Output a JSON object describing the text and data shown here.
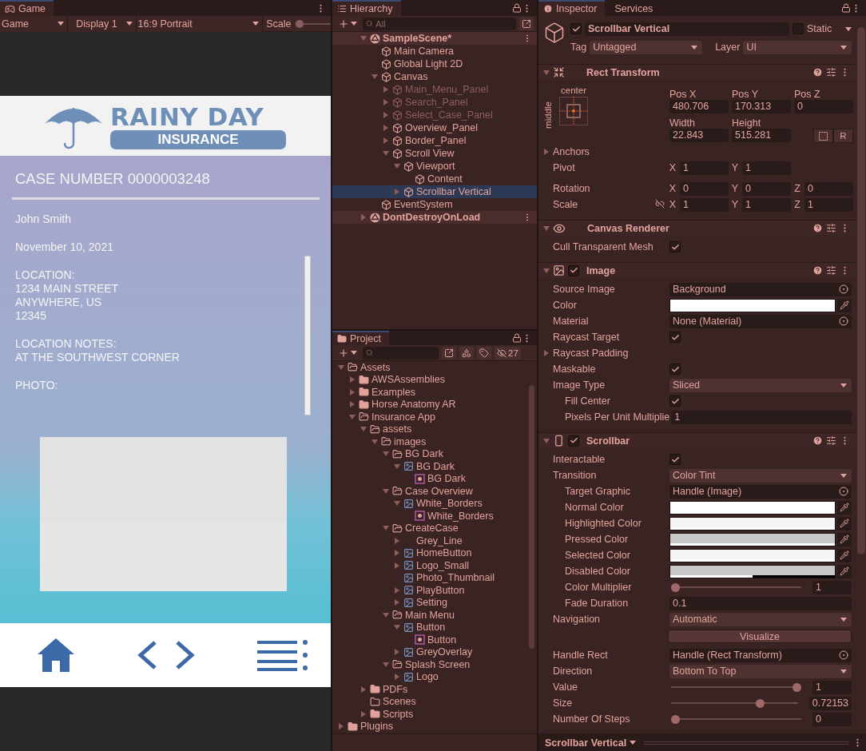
{
  "game": {
    "tab": "Game",
    "toolbar": {
      "mode": "Game",
      "display": "Display 1",
      "aspect": "16:9 Portrait",
      "scale_label": "Scale",
      "scale": {
        "level": 0
      }
    },
    "app": {
      "logo": {
        "title": "RAINY DAY",
        "subtitle": "INSURANCE"
      },
      "case_number": "CASE NUMBER 0000003248",
      "blocks": [
        {
          "lines": [
            "John Smith"
          ]
        },
        {
          "lines": [
            "November 10, 2021"
          ]
        },
        {
          "lines": [
            "LOCATION:",
            "1234 MAIN STREET",
            "ANYWHERE, US",
            "12345"
          ]
        },
        {
          "lines": [
            "LOCATION NOTES:",
            "AT THE SOUTHWEST CORNER"
          ]
        },
        {
          "lines": [
            "PHOTO:"
          ]
        }
      ]
    }
  },
  "hierarchy": {
    "tab": "Hierarchy",
    "search_placeholder": "All",
    "items": [
      {
        "name": "SampleScene*",
        "kind": "scene",
        "expanded": true,
        "selected": false,
        "disabled": false,
        "children": [
          {
            "name": "Main Camera",
            "kind": "object",
            "selected": false,
            "disabled": false
          },
          {
            "name": "Global Light 2D",
            "kind": "object",
            "selected": false,
            "disabled": false
          },
          {
            "name": "Canvas",
            "kind": "object",
            "expanded": true,
            "selected": false,
            "disabled": false,
            "children": [
              {
                "name": "Main_Menu_Panel",
                "kind": "object",
                "expanded": false,
                "selected": false,
                "disabled": true
              },
              {
                "name": "Search_Panel",
                "kind": "object",
                "expanded": false,
                "selected": false,
                "disabled": true
              },
              {
                "name": "Select_Case_Panel",
                "kind": "object",
                "expanded": false,
                "selected": false,
                "disabled": true
              },
              {
                "name": "Overview_Panel",
                "kind": "object",
                "expanded": false,
                "selected": false,
                "disabled": false
              },
              {
                "name": "Border_Panel",
                "kind": "object",
                "expanded": false,
                "selected": false,
                "disabled": false
              },
              {
                "name": "Scroll View",
                "kind": "object",
                "expanded": true,
                "selected": false,
                "disabled": false,
                "children": [
                  {
                    "name": "Viewport",
                    "kind": "object",
                    "expanded": true,
                    "selected": false,
                    "disabled": false,
                    "children": [
                      {
                        "name": "Content",
                        "kind": "object",
                        "selected": false,
                        "disabled": false
                      }
                    ]
                  },
                  {
                    "name": "Scrollbar Vertical",
                    "kind": "object",
                    "expanded": false,
                    "selected": true,
                    "disabled": false
                  }
                ]
              }
            ]
          },
          {
            "name": "EventSystem",
            "kind": "object",
            "selected": false,
            "disabled": false
          }
        ]
      },
      {
        "name": "DontDestroyOnLoad",
        "kind": "scene",
        "expanded": false,
        "selected": false,
        "disabled": false
      }
    ]
  },
  "project": {
    "tab": "Project",
    "hidden_count": "27",
    "items": [
      {
        "name": "Assets",
        "kind": "folder",
        "expanded": true,
        "children": [
          {
            "name": "AWSAssemblies",
            "kind": "folder",
            "expanded": false
          },
          {
            "name": "Examples",
            "kind": "folder",
            "expanded": false
          },
          {
            "name": "Horse Anatomy AR",
            "kind": "folder",
            "expanded": false
          },
          {
            "name": "Insurance App",
            "kind": "folder",
            "expanded": true,
            "children": [
              {
                "name": "assets",
                "kind": "folder",
                "expanded": true,
                "children": [
                  {
                    "name": "images",
                    "kind": "folder",
                    "expanded": true,
                    "children": [
                      {
                        "name": "BG Dark",
                        "kind": "folder",
                        "expanded": true,
                        "children": [
                          {
                            "name": "BG Dark",
                            "kind": "texture",
                            "expanded": true,
                            "children": [
                              {
                                "name": "BG Dark",
                                "kind": "sprite"
                              }
                            ]
                          }
                        ]
                      },
                      {
                        "name": "Case Overview",
                        "kind": "folder",
                        "expanded": true,
                        "children": [
                          {
                            "name": "White_Borders",
                            "kind": "texture",
                            "expanded": true,
                            "children": [
                              {
                                "name": "White_Borders",
                                "kind": "sprite"
                              }
                            ]
                          }
                        ]
                      },
                      {
                        "name": "CreateCase",
                        "kind": "folder",
                        "expanded": true,
                        "children": [
                          {
                            "name": "Grey_Line",
                            "kind": "blank",
                            "expanded": false
                          },
                          {
                            "name": "HomeButton",
                            "kind": "texture",
                            "expanded": false
                          },
                          {
                            "name": "Logo_Small",
                            "kind": "texture",
                            "expanded": false
                          },
                          {
                            "name": "Photo_Thumbnail",
                            "kind": "texture"
                          },
                          {
                            "name": "PlayButton",
                            "kind": "texture",
                            "expanded": false
                          },
                          {
                            "name": "Setting",
                            "kind": "texture",
                            "expanded": false
                          }
                        ]
                      },
                      {
                        "name": "Main Menu",
                        "kind": "folder",
                        "expanded": true,
                        "children": [
                          {
                            "name": "Button",
                            "kind": "texture",
                            "expanded": true,
                            "children": [
                              {
                                "name": "Button",
                                "kind": "sprite"
                              }
                            ]
                          },
                          {
                            "name": "GreyOverlay",
                            "kind": "texture",
                            "expanded": false
                          }
                        ]
                      },
                      {
                        "name": "Splash Screen",
                        "kind": "folder",
                        "expanded": true,
                        "children": [
                          {
                            "name": "Logo",
                            "kind": "texture",
                            "expanded": false
                          }
                        ]
                      }
                    ]
                  }
                ]
              },
              {
                "name": "PDFs",
                "kind": "folder",
                "expanded": false
              },
              {
                "name": "Scenes",
                "kind": "empty-folder"
              },
              {
                "name": "Scripts",
                "kind": "folder",
                "expanded": false
              }
            ]
          }
        ]
      },
      {
        "name": "Plugins",
        "kind": "folder",
        "expanded": false
      }
    ]
  },
  "inspector": {
    "tabs": [
      {
        "label": "Inspector",
        "selected": true
      },
      {
        "label": "Services",
        "selected": false
      }
    ],
    "object": {
      "active": true,
      "name": "Scrollbar Vertical",
      "static": false,
      "static_label": "Static",
      "tag_label": "Tag",
      "tag": "Untagged",
      "layer_label": "Layer",
      "layer": "UI"
    },
    "rect_transform": {
      "title": "Rect Transform",
      "anchor": {
        "horizontal": "center",
        "vertical": "middle"
      },
      "fields": [
        {
          "label": "Pos X",
          "value": "480.706"
        },
        {
          "label": "Pos Y",
          "value": "170.313"
        },
        {
          "label": "Pos Z",
          "value": "0"
        },
        {
          "label": "Width",
          "value": "22.843"
        },
        {
          "label": "Height",
          "value": "515.281"
        }
      ],
      "raw_button": "R",
      "anchors": "Anchors",
      "vectors": [
        {
          "label": "Pivot",
          "axes": [
            {
              "axis": "X",
              "value": "1"
            },
            {
              "axis": "Y",
              "value": "1"
            }
          ]
        },
        {
          "label": "Rotation",
          "axes": [
            {
              "axis": "X",
              "value": "0"
            },
            {
              "axis": "Y",
              "value": "0"
            },
            {
              "axis": "Z",
              "value": "0"
            }
          ]
        },
        {
          "label": "Scale",
          "linked": false,
          "axes": [
            {
              "axis": "X",
              "value": "1"
            },
            {
              "axis": "Y",
              "value": "1"
            },
            {
              "axis": "Z",
              "value": "1"
            }
          ]
        }
      ]
    },
    "components": [
      {
        "title": "Canvas Renderer",
        "kind": "canvas-renderer",
        "properties": [
          {
            "kind": "check",
            "label": "Cull Transparent Mesh",
            "checked": true
          }
        ]
      },
      {
        "title": "Image",
        "kind": "image",
        "enabled": true,
        "properties": [
          {
            "kind": "object",
            "label": "Source Image",
            "value": "Background"
          },
          {
            "kind": "color",
            "label": "Color",
            "color": "#ffffff",
            "level": 1
          },
          {
            "kind": "object",
            "label": "Material",
            "value": "None (Material)"
          },
          {
            "kind": "check",
            "label": "Raycast Target",
            "checked": true
          },
          {
            "kind": "foldout",
            "label": "Raycast Padding"
          },
          {
            "kind": "check",
            "label": "Maskable",
            "checked": true
          },
          {
            "kind": "dropdown",
            "label": "Image Type",
            "value": "Sliced",
            "children": [
              {
                "kind": "check",
                "label": "Fill Center",
                "checked": true
              },
              {
                "kind": "field",
                "label": "Pixels Per Unit Multiplie",
                "value": "1"
              }
            ]
          }
        ]
      },
      {
        "title": "Scrollbar",
        "kind": "scrollbar",
        "enabled": true,
        "properties": [
          {
            "kind": "check",
            "label": "Interactable",
            "checked": true
          },
          {
            "kind": "dropdown",
            "label": "Transition",
            "value": "Color Tint",
            "children": [
              {
                "kind": "object",
                "label": "Target Graphic",
                "value": "Handle (Image)"
              },
              {
                "kind": "color",
                "label": "Normal Color",
                "color": "#ffffff",
                "level": 1
              },
              {
                "kind": "color",
                "label": "Highlighted Color",
                "color": "#f5f5f5",
                "level": 1
              },
              {
                "kind": "color",
                "label": "Pressed Color",
                "color": "#c8c8c8",
                "level": 1
              },
              {
                "kind": "color",
                "label": "Selected Color",
                "color": "#f5f5f5",
                "level": 1
              },
              {
                "kind": "color",
                "label": "Disabled Color",
                "color": "#c8c8c8",
                "level": 0.5
              },
              {
                "kind": "slider",
                "label": "Color Multiplier",
                "level": 0,
                "value": "1"
              },
              {
                "kind": "field",
                "label": "Fade Duration",
                "value": "0.1"
              }
            ]
          },
          {
            "kind": "dropdown",
            "label": "Navigation",
            "value": "Automatic"
          },
          {
            "kind": "button",
            "label": "Visualize"
          },
          {
            "kind": "object",
            "label": "Handle Rect",
            "value": "Handle (Rect Transform)"
          },
          {
            "kind": "dropdown",
            "label": "Direction",
            "value": "Bottom To Top"
          },
          {
            "kind": "slider",
            "label": "Value",
            "level": 1,
            "value": "1"
          },
          {
            "kind": "slider",
            "label": "Size",
            "level": 0.72,
            "value": "0.72153"
          },
          {
            "kind": "slider",
            "label": "Number Of Steps",
            "level": 0,
            "value": "0"
          }
        ]
      }
    ],
    "footer": "Scrollbar Vertical"
  }
}
